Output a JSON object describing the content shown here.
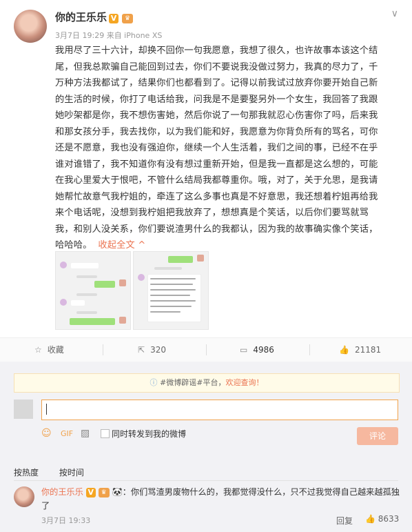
{
  "post": {
    "author": "你的王乐乐",
    "badge_v": "V",
    "meta": "3月7日 19:29 来自 iPhone XS",
    "body_lines": [
      "我用尽了三十六计，却换不回你一句我愿意，我想了很久，也许故事本该这个结",
      "尾，但我总欺骗自己能回到过去，你们不要说我没做过努力，我真的尽力了，千",
      "万种方法我都试了，结果你们也都看到了。记得以前我试过放弃你要开始自己新",
      "的生活的时候，你打了电话给我，问我是不是要娶另外一个女生，我回答了我跟",
      "她吵架都是你，我不想伤害她，然后你说了一句那我就忍心伤害你了吗，后来我",
      "和那女孩分手，我去找你，以为我们能和好，我愿意为你背负所有的骂名，可你",
      "还是不愿意，我也没有强迫你，继续一个人生活着，我们之间的事，已经不在乎",
      "谁对谁错了，我不知道你有没有想过重新开始，但是我一直都是这么想的，可能",
      "在我心里爱大于恨吧，不管什么结局我都尊重你。哦，对了，关于允思，是我请",
      "她帮忙故意气我柠姐的，牵连了这么多事也真是不好意思，我还想着柠姐再给我",
      "来个电话呢，没想到我柠姐把我放弃了，想想真是个笑话，以后你们要骂就骂",
      "我，和别人没关系，你们要说渣男什么的我都认，因为我的故事确实像个笑话，"
    ],
    "last_line": "哈哈哈。",
    "collapse_label": "收起全文 ^"
  },
  "actions": {
    "favorite_label": "收藏",
    "repost_count": "320",
    "comment_count": "4986",
    "like_count": "21181"
  },
  "comments": {
    "notice_prefix": "#微博辟谣#平台，",
    "notice_highlight": "欢迎查询！",
    "forward_label": "同时转发到我的微博",
    "submit_label": "评论",
    "tab_hot": "按热度",
    "tab_time": "按时间",
    "items": [
      {
        "author": "你的王乐乐",
        "text": "：你们骂渣男废物什么的，我都觉得没什么，只不过我觉得自己越来越孤独了",
        "time": "3月7日 19:33",
        "reply_label": "回复",
        "likes": "8633"
      }
    ]
  },
  "icons": {
    "chevron": "chevron-down-icon",
    "favorite": "star-icon",
    "repost": "share-icon",
    "comment": "comment-icon",
    "like": "thumbs-up-icon",
    "emoji": "emoji-icon",
    "gif": "gif-icon",
    "image": "image-icon"
  },
  "colors": {
    "accent": "#eb7350",
    "badge": "#f5a623",
    "submit_disabled": "#f6b89f"
  }
}
